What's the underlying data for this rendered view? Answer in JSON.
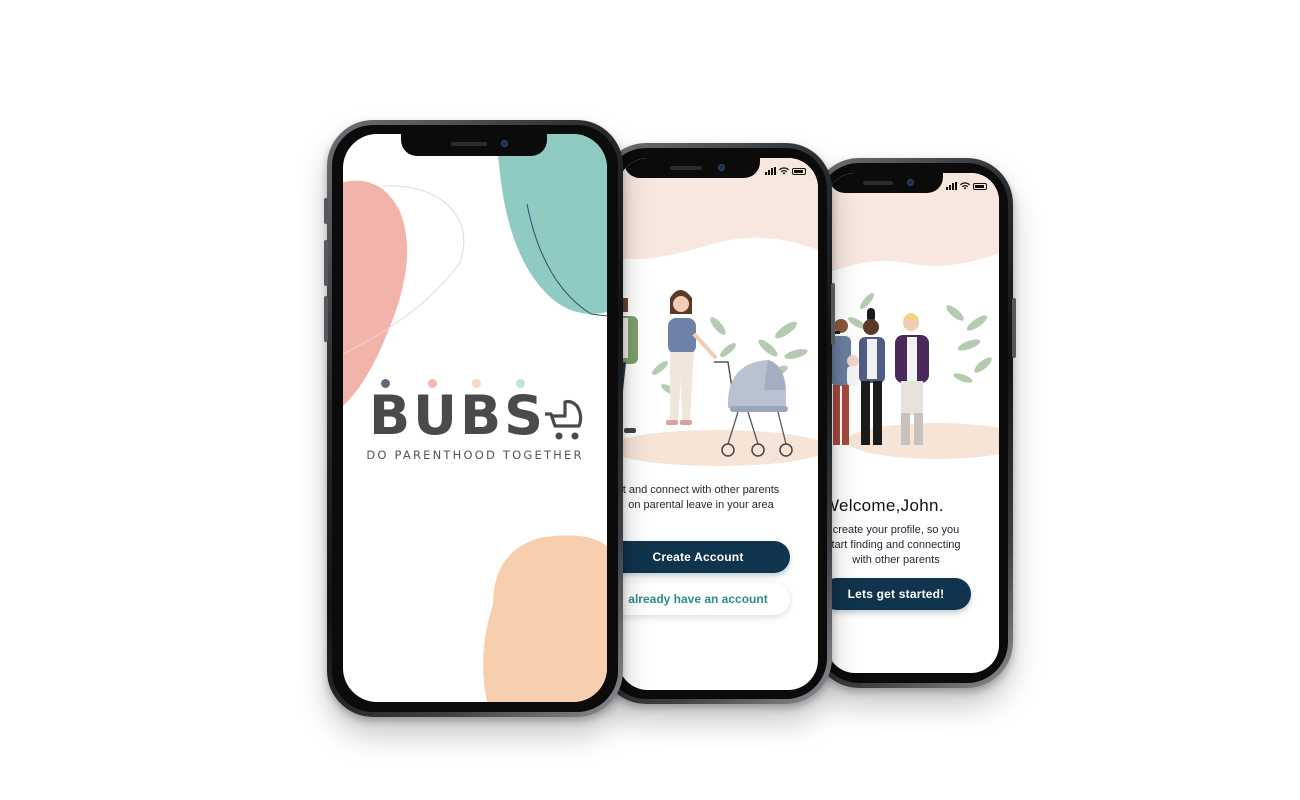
{
  "splash": {
    "logo_text": "BUBS",
    "tagline": "DO PARENTHOOD TOGETHER",
    "dot_colors": [
      "#5f6b7a",
      "#f3b7ae",
      "#f6d9c6",
      "#bfe3de"
    ]
  },
  "onboarding": {
    "body_line1": "t and connect with other parents",
    "body_line2": "on parental leave in your area",
    "create_account_label": "Create Account",
    "have_account_label": "already have an account"
  },
  "welcome_screen": {
    "title": "Welcome,John.",
    "body_line1": "create your profile, so you",
    "body_line2": "tart finding and connecting",
    "body_line3": "with other parents",
    "start_label": "Lets get started!"
  },
  "colors": {
    "primary_button": "#10344d",
    "secondary_text": "#2d8b86",
    "blob_teal": "#8fcac3",
    "blob_pink": "#f2b4aa",
    "blob_peach": "#f7cfae",
    "header_blush": "#f8e7df",
    "ground_beige": "#f6e4d6"
  },
  "status_bar": {
    "icons": [
      "signal-icon",
      "wifi-icon",
      "battery-icon"
    ]
  }
}
